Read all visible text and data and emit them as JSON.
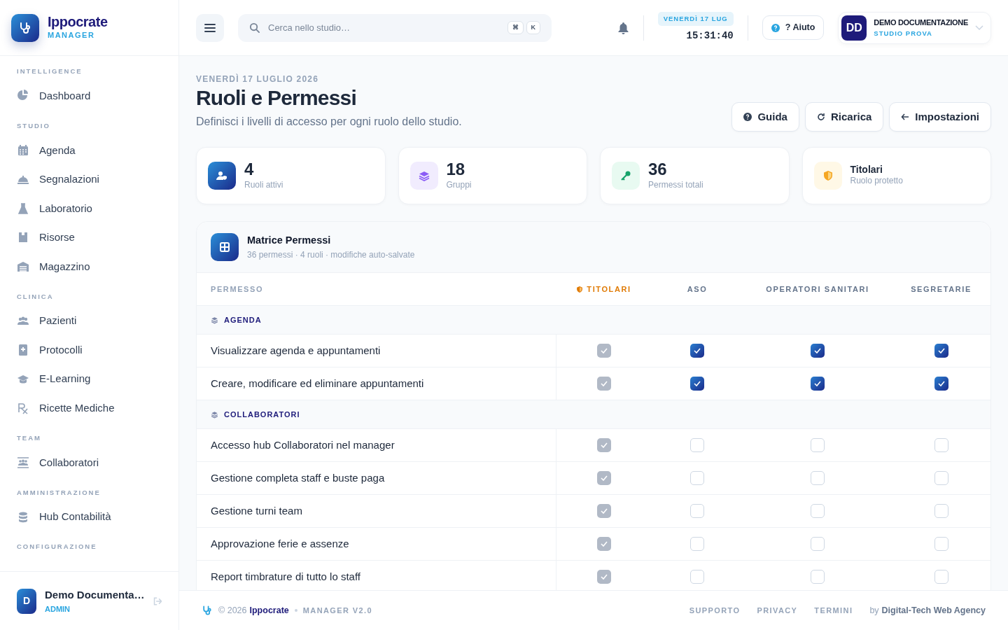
{
  "brand": {
    "name": "Ippocrate",
    "subtitle": "MANAGER"
  },
  "sidebar": {
    "sections": [
      {
        "title": "INTELLIGENCE",
        "items": [
          {
            "label": "Dashboard"
          }
        ]
      },
      {
        "title": "STUDIO",
        "items": [
          {
            "label": "Agenda"
          },
          {
            "label": "Segnalazioni"
          },
          {
            "label": "Laboratorio"
          },
          {
            "label": "Risorse"
          },
          {
            "label": "Magazzino"
          }
        ]
      },
      {
        "title": "CLINICA",
        "items": [
          {
            "label": "Pazienti"
          },
          {
            "label": "Protocolli"
          },
          {
            "label": "E-Learning"
          },
          {
            "label": "Ricette Mediche"
          }
        ]
      },
      {
        "title": "TEAM",
        "items": [
          {
            "label": "Collaboratori"
          }
        ]
      },
      {
        "title": "AMMINISTRAZIONE",
        "items": [
          {
            "label": "Hub Contabilità"
          }
        ]
      },
      {
        "title": "CONFIGURAZIONE"
      }
    ],
    "user": {
      "initial": "D",
      "name": "Demo Documenta…",
      "role": "ADMIN"
    }
  },
  "topbar": {
    "search": {
      "placeholder": "Cerca nello studio…",
      "keys": [
        "⌘",
        "K"
      ]
    },
    "date": "VENERDÌ 17 LUG",
    "time": "15:31:40",
    "help": "? Aiuto",
    "account": {
      "initials": "DD",
      "name": "DEMO DOCUMENTAZIONE",
      "studio": "STUDIO PROVA"
    }
  },
  "page": {
    "date": "VENERDÌ 17 LUGLIO 2026",
    "title": "Ruoli e Permessi",
    "subtitle": "Definisci i livelli di accesso per ogni ruolo dello studio.",
    "actions": [
      "Guida",
      "Ricarica",
      "Impostazioni"
    ]
  },
  "stats": [
    {
      "kind": "number",
      "value": "4",
      "label": "Ruoli attivi"
    },
    {
      "kind": "number",
      "value": "18",
      "label": "Gruppi"
    },
    {
      "kind": "number",
      "value": "36",
      "label": "Permessi totali"
    },
    {
      "kind": "text",
      "value": "Titolari",
      "label": "Ruolo protetto"
    }
  ],
  "matrix": {
    "title": "Matrice Permessi",
    "subtitle": "36 permessi · 4 ruoli · modifiche auto-salvate",
    "columns": [
      {
        "label": "PERMESSO",
        "protected": false
      },
      {
        "label": "TITOLARI",
        "protected": true
      },
      {
        "label": "ASO",
        "protected": false
      },
      {
        "label": "OPERATORI SANITARI",
        "protected": false
      },
      {
        "label": "SEGRETARIE",
        "protected": false
      }
    ],
    "groups": [
      {
        "label": "AGENDA",
        "rows": [
          {
            "label": "Visualizzare agenda e appuntamenti",
            "checks": [
              {
                "checked": true,
                "disabled": true
              },
              {
                "checked": true,
                "disabled": false
              },
              {
                "checked": true,
                "disabled": false
              },
              {
                "checked": true,
                "disabled": false
              }
            ]
          },
          {
            "label": "Creare, modificare ed eliminare appuntamenti",
            "checks": [
              {
                "checked": true,
                "disabled": true
              },
              {
                "checked": true,
                "disabled": false
              },
              {
                "checked": true,
                "disabled": false
              },
              {
                "checked": true,
                "disabled": false
              }
            ]
          }
        ]
      },
      {
        "label": "COLLABORATORI",
        "rows": [
          {
            "label": "Accesso hub Collaboratori nel manager",
            "checks": [
              {
                "checked": true,
                "disabled": true
              },
              {
                "checked": false,
                "disabled": false
              },
              {
                "checked": false,
                "disabled": false
              },
              {
                "checked": false,
                "disabled": false
              }
            ]
          },
          {
            "label": "Gestione completa staff e buste paga",
            "checks": [
              {
                "checked": true,
                "disabled": true
              },
              {
                "checked": false,
                "disabled": false
              },
              {
                "checked": false,
                "disabled": false
              },
              {
                "checked": false,
                "disabled": false
              }
            ]
          },
          {
            "label": "Gestione turni team",
            "checks": [
              {
                "checked": true,
                "disabled": true
              },
              {
                "checked": false,
                "disabled": false
              },
              {
                "checked": false,
                "disabled": false
              },
              {
                "checked": false,
                "disabled": false
              }
            ]
          },
          {
            "label": "Approvazione ferie e assenze",
            "checks": [
              {
                "checked": true,
                "disabled": true
              },
              {
                "checked": false,
                "disabled": false
              },
              {
                "checked": false,
                "disabled": false
              },
              {
                "checked": false,
                "disabled": false
              }
            ]
          },
          {
            "label": "Report timbrature di tutto lo staff",
            "checks": [
              {
                "checked": true,
                "disabled": true
              },
              {
                "checked": false,
                "disabled": false
              },
              {
                "checked": false,
                "disabled": false
              },
              {
                "checked": false,
                "disabled": false
              }
            ]
          }
        ]
      }
    ]
  },
  "footer": {
    "copyright": "© 2026",
    "brand": "Ippocrate",
    "version": "MANAGER V2.0",
    "links": [
      "SUPPORTO",
      "PRIVACY",
      "TERMINI"
    ],
    "credit_prefix": "by",
    "credit": "Digital-Tech Web Agency"
  }
}
